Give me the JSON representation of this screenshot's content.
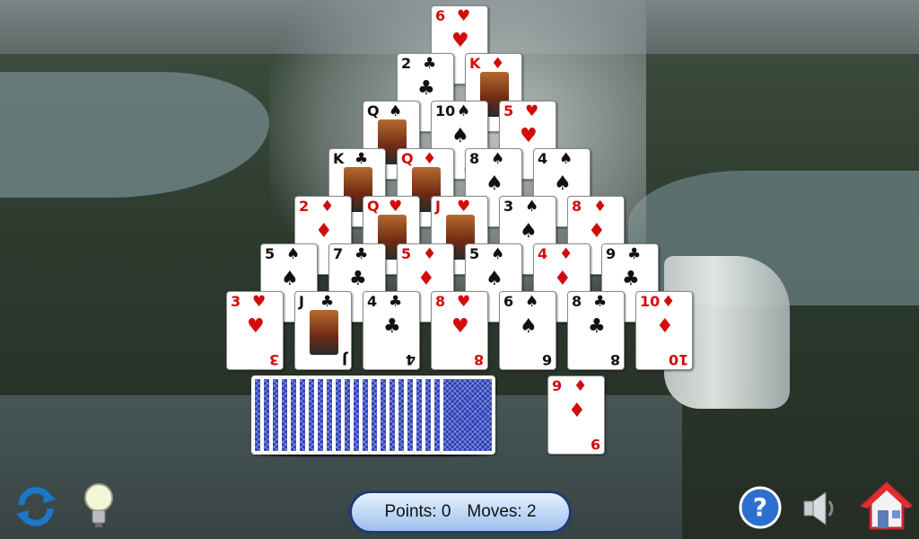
{
  "score": {
    "points_label": "Points: 0",
    "moves_label": "Moves: 2"
  },
  "pyramid_rows": [
    [
      {
        "rank": "6",
        "suit": "♥",
        "color": "red"
      }
    ],
    [
      {
        "rank": "2",
        "suit": "♣",
        "color": "black"
      },
      {
        "rank": "K",
        "suit": "♦",
        "color": "red",
        "face": true
      }
    ],
    [
      {
        "rank": "Q",
        "suit": "♠",
        "color": "black",
        "face": true
      },
      {
        "rank": "10",
        "suit": "♠",
        "color": "black"
      },
      {
        "rank": "5",
        "suit": "♥",
        "color": "red"
      }
    ],
    [
      {
        "rank": "K",
        "suit": "♣",
        "color": "black",
        "face": true
      },
      {
        "rank": "Q",
        "suit": "♦",
        "color": "red",
        "face": true
      },
      {
        "rank": "8",
        "suit": "♠",
        "color": "black"
      },
      {
        "rank": "4",
        "suit": "♠",
        "color": "black"
      }
    ],
    [
      {
        "rank": "2",
        "suit": "♦",
        "color": "red"
      },
      {
        "rank": "Q",
        "suit": "♥",
        "color": "red",
        "face": true
      },
      {
        "rank": "J",
        "suit": "♥",
        "color": "red",
        "face": true
      },
      {
        "rank": "3",
        "suit": "♠",
        "color": "black"
      },
      {
        "rank": "8",
        "suit": "♦",
        "color": "red"
      }
    ],
    [
      {
        "rank": "5",
        "suit": "♠",
        "color": "black"
      },
      {
        "rank": "7",
        "suit": "♣",
        "color": "black"
      },
      {
        "rank": "5",
        "suit": "♦",
        "color": "red"
      },
      {
        "rank": "5",
        "suit": "♠",
        "color": "black"
      },
      {
        "rank": "4",
        "suit": "♦",
        "color": "red"
      },
      {
        "rank": "9",
        "suit": "♣",
        "color": "black"
      }
    ],
    [
      {
        "rank": "3",
        "suit": "♥",
        "color": "red"
      },
      {
        "rank": "J",
        "suit": "♣",
        "color": "black",
        "face": true
      },
      {
        "rank": "4",
        "suit": "♣",
        "color": "black"
      },
      {
        "rank": "8",
        "suit": "♥",
        "color": "red"
      },
      {
        "rank": "6",
        "suit": "♠",
        "color": "black"
      },
      {
        "rank": "8",
        "suit": "♣",
        "color": "black"
      },
      {
        "rank": "10",
        "suit": "♦",
        "color": "red"
      }
    ]
  ],
  "waste_card": {
    "rank": "9",
    "suit": "♦",
    "color": "red"
  },
  "stock_count": 22,
  "toolbar": {
    "new_game_icon": "refresh-arrows-icon",
    "hint_icon": "lightbulb-icon",
    "help_icon": "question-mark-icon",
    "help_glyph": "?",
    "sound_icon": "speaker-icon",
    "home_icon": "home-icon"
  },
  "colors": {
    "red": "#d20c0c",
    "black": "#111111",
    "card_back": "#2c3fb8",
    "score_border": "#1f3a78"
  }
}
